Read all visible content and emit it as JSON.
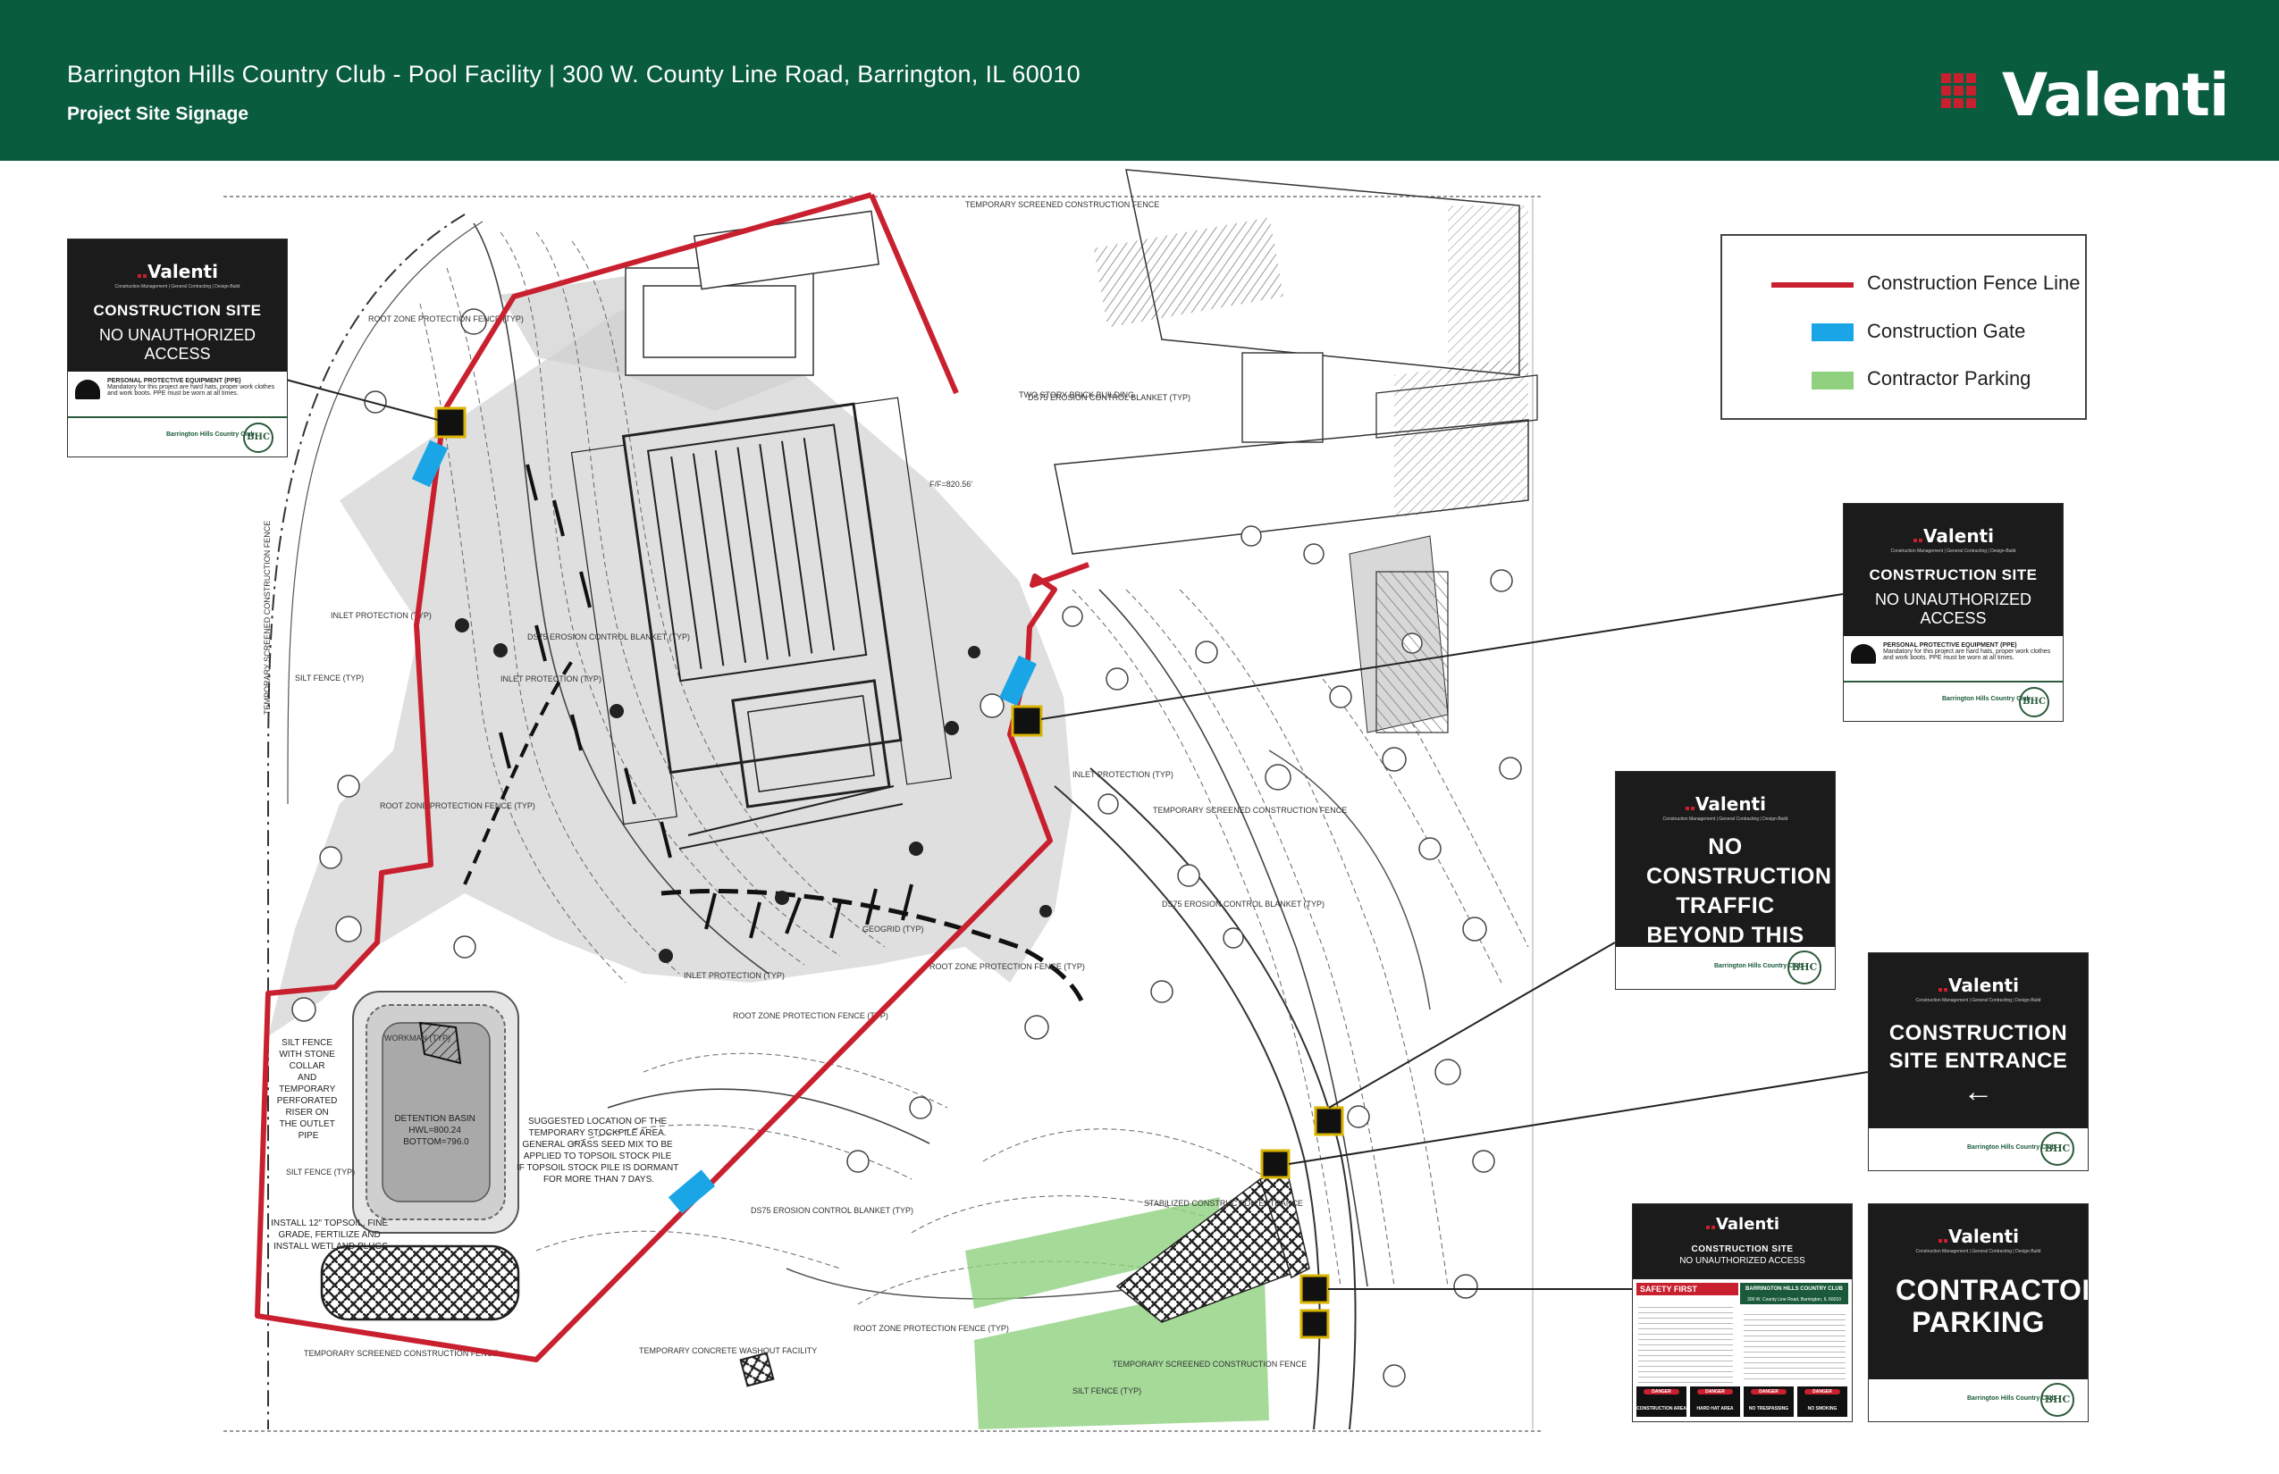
{
  "header": {
    "title": "Barrington Hills Country Club - Pool Facility  |  300 W. County Line Road, Barrington, IL 60010",
    "subtitle": "Project Site Signage",
    "brand": "Valenti",
    "bg_color": "#0a5c3f",
    "brand_red": "#c8202f"
  },
  "legend": {
    "items": [
      {
        "label": "Construction Fence Line",
        "color": "#c8202f",
        "kind": "line"
      },
      {
        "label": "Construction Gate",
        "color": "#1aa6e6",
        "kind": "box"
      },
      {
        "label": "Contractor Parking",
        "color": "#8fd17f",
        "kind": "box"
      }
    ]
  },
  "plan_labels": {
    "temp_fence_top": "TEMPORARY SCREENED CONSTRUCTION FENCE",
    "root_zone": "ROOT ZONE PROTECTION FENCE (TYP)",
    "erosion_blanket": "DS75 EROSION CONTROL BLANKET (TYP)",
    "inlet_protection": "INLET PROTECTION (TYP)",
    "silt_fence": "SILT FENCE (TYP)",
    "temp_fence_side": "TEMPORARY SCREENED CONSTRUCTION FENCE",
    "brick_building": "TWO STORY BRICK BUILDING",
    "stockpile": "SUGGESTED LOCATION OF THE TEMPORARY STOCKPILE AREA. GENERAL GRASS SEED MIX TO BE APPLIED TO TOPSOIL STOCK PILE IF TOPSOIL STOCK PILE IS DORMANT FOR MORE THAN 7 DAYS.",
    "detention": "DETENTION BASIN HWL=800.24 BOTTOM=796.0",
    "wetland": "INSTALL 12\" TOPSOIL, FINE GRADE, FERTILIZE AND INSTALL WETLAND PLUGS",
    "washout": "TEMPORARY CONCRETE WASHOUT FACILITY",
    "stabilized": "STABILIZED CONSTRUCTION ENTRANCE",
    "silt_collar": "SILT FENCE WITH STONE COLLAR AND TEMPORARY PERFORATED RISER ON THE OUTLET PIPE",
    "workman": "WORKMAN (TYP)",
    "fire": "F/F=820.56'",
    "geogrid": "GEOGRID (TYP)"
  },
  "signs": {
    "logo": "Valenti",
    "logo_tagline": "Construction Management | General Contracting | Design-Build",
    "club": "Barrington Hills Country Club",
    "seal": "BHC",
    "site": {
      "line1": "CONSTRUCTION SITE",
      "line2": "NO UNAUTHORIZED ACCESS",
      "ppe_title": "PERSONAL PROTECTIVE EQUIPMENT (PPE)",
      "ppe_text": "Mandatory for this project are hard hats, proper work clothes and work boots. PPE must be worn at all times."
    },
    "no_traffic": "NO CONSTRUCTION TRAFFIC BEYOND THIS POINT",
    "entrance": "CONSTRUCTION SITE ENTRANCE",
    "parking": "CONTRACTOR PARKING",
    "info": {
      "line1": "CONSTRUCTION SITE",
      "line2": "NO UNAUTHORIZED ACCESS",
      "safety": "SAFETY FIRST",
      "club_block": "BARRINGTON HILLS COUNTRY CLUB",
      "address": "300 W. County Line Road, Barrington, IL 60010",
      "danger": "DANGER",
      "d1": "CONSTRUCTION AREA",
      "d2": "HARD HAT AREA",
      "d3": "NO TRESPASSING",
      "d4": "NO SMOKING"
    }
  }
}
